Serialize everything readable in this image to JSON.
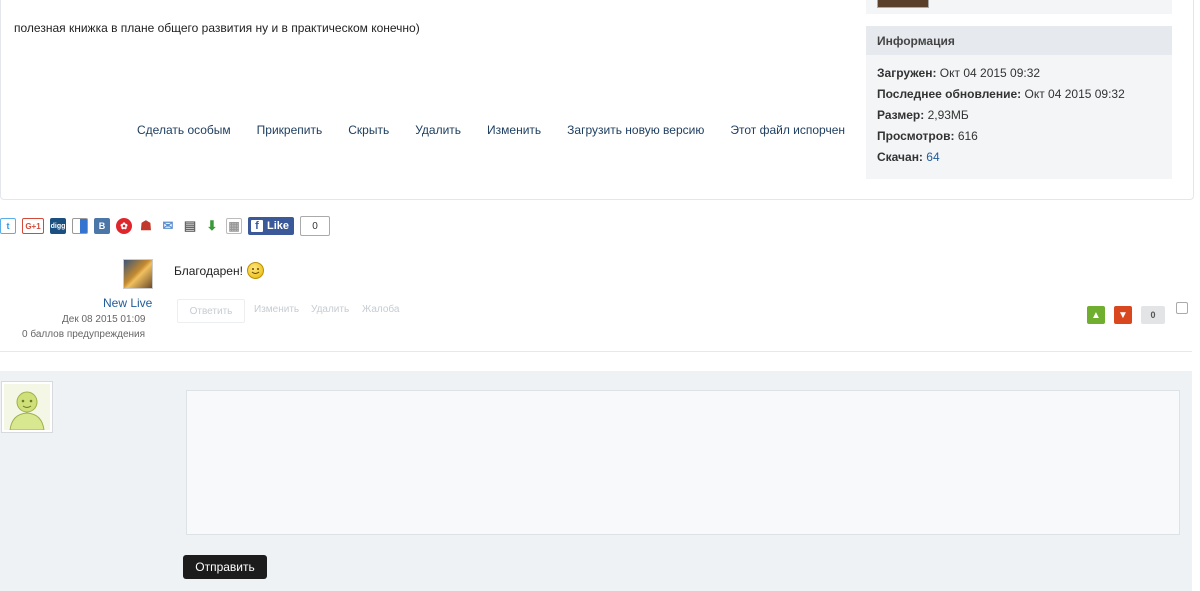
{
  "file": {
    "description": "полезная книжка в плане общего развития ну и в практическом конечно)",
    "actions": [
      "Сделать особым",
      "Прикрепить",
      "Скрыть",
      "Удалить",
      "Изменить",
      "Загрузить новую версию",
      "Этот файл испорчен"
    ]
  },
  "info": {
    "title": "Информация",
    "uploaded_label": "Загружен:",
    "uploaded_value": "Окт 04 2015 09:32",
    "updated_label": "Последнее обновление:",
    "updated_value": "Окт 04 2015 09:32",
    "size_label": "Размер:",
    "size_value": "2,93МБ",
    "views_label": "Просмотров:",
    "views_value": "616",
    "downloads_label": "Скачан:",
    "downloads_value": "64"
  },
  "share": {
    "icons": [
      "twitter-icon",
      "google-plus-icon",
      "digg-icon",
      "delicious-icon",
      "vkontakte-icon",
      "odnoklassniki-icon",
      "moimir-icon",
      "email-icon",
      "print-icon",
      "download-icon",
      "bookmark-icon"
    ],
    "google_plus_text": "G+1",
    "digg_text": "digg",
    "vk_text": "В",
    "fb_like": "Like",
    "fb_count": "0"
  },
  "comment": {
    "author": "New Live",
    "date": "Дек 08 2015 01:09",
    "warnings": "0 баллов предупреждения",
    "text": "Благодарен!",
    "reply": "Ответить",
    "edit": "Изменить",
    "delete": "Удалить",
    "report": "Жалоба",
    "votes": "0",
    "colors": {
      "vote_up": "#6fae2e",
      "vote_down": "#d9471f"
    }
  },
  "reply_form": {
    "submit": "Отправить"
  }
}
